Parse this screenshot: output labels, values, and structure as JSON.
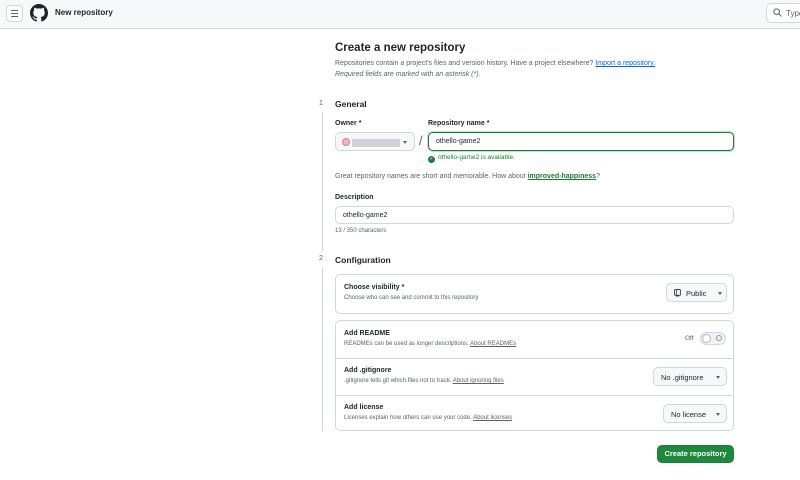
{
  "topbar": {
    "title": "New repository",
    "search_placeholder": "Type"
  },
  "page": {
    "heading": "Create a new repository",
    "subtitle": "Repositories contain a project's files and version history. Have a project elsewhere?",
    "import_link": "Import a repository.",
    "required_note": "Required fields are marked with an asterisk (*)."
  },
  "general": {
    "step": "1",
    "title": "General",
    "owner_label": "Owner *",
    "repo_name_label": "Repository name *",
    "repo_name_value": "othello-game2",
    "availability": "othello-game2 is available.",
    "hint_prefix": "Great repository names are short and memorable. How about",
    "hint_suggestion": "improved-happiness",
    "hint_suffix": "?",
    "description_label": "Description",
    "description_value": "othello-game2",
    "char_count": "13 / 350 characters"
  },
  "configuration": {
    "step": "2",
    "title": "Configuration",
    "visibility": {
      "title": "Choose visibility *",
      "desc": "Choose who can see and commit to this repository",
      "value": "Public"
    },
    "readme": {
      "title": "Add README",
      "desc": "READMEs can be used as longer descriptions.",
      "link": "About READMEs",
      "toggle_label": "Off",
      "enabled": false
    },
    "gitignore": {
      "title": "Add .gitignore",
      "desc": ".gitignore tells git which files not to track.",
      "link": "About ignoring files",
      "value": "No .gitignore"
    },
    "license": {
      "title": "Add license",
      "desc": "Licenses explain how others can use your code.",
      "link": "About licenses",
      "value": "No license"
    }
  },
  "actions": {
    "create_label": "Create repository"
  },
  "colors": {
    "primary_button": "#1f883d",
    "link": "#0969da",
    "success": "#1a7f37"
  },
  "icons": {
    "menu": "hamburger-icon",
    "logo": "github-logo",
    "search": "search-icon",
    "visibility": "repo-icon",
    "check": "check-circle-icon"
  }
}
